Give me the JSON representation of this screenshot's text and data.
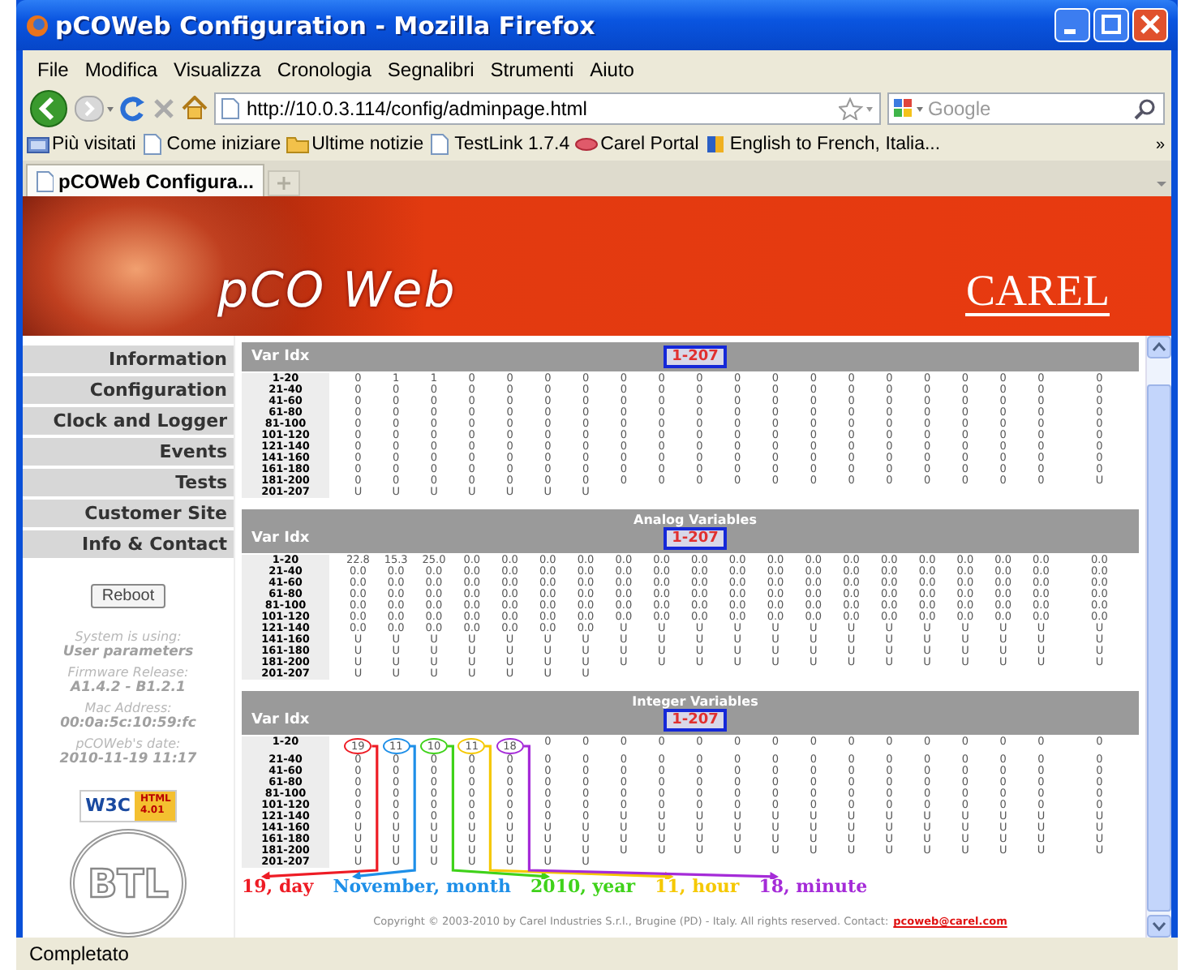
{
  "window": {
    "title": "pCOWeb Configuration - Mozilla Firefox"
  },
  "menu": [
    "File",
    "Modifica",
    "Visualizza",
    "Cronologia",
    "Segnalibri",
    "Strumenti",
    "Aiuto"
  ],
  "address": {
    "value": "http://10.0.3.114/config/adminpage.html"
  },
  "search": {
    "placeholder": "Google"
  },
  "bookmarks": [
    {
      "label": "Più visitati",
      "kind": "smart"
    },
    {
      "label": "Come iniziare",
      "kind": "page"
    },
    {
      "label": "Ultime notizie",
      "kind": "folder"
    },
    {
      "label": "TestLink 1.7.4",
      "kind": "page"
    },
    {
      "label": "Carel Portal",
      "kind": "carel"
    },
    {
      "label": "English to French, Italia...",
      "kind": "flag"
    }
  ],
  "bookmarks_overflow": "»",
  "tabs": [
    {
      "label": "pCOWeb Configura...",
      "selected": true
    }
  ],
  "banner": {
    "logo": "pCO Web",
    "brand": "CAREL"
  },
  "sidebar": {
    "items": [
      {
        "label": "Information"
      },
      {
        "label": "Configuration"
      },
      {
        "label": "Clock and Logger"
      },
      {
        "label": "Events"
      },
      {
        "label": "Tests"
      },
      {
        "label": "Customer Site"
      },
      {
        "label": "Info & Contact"
      }
    ],
    "button": "Reboot",
    "info": [
      {
        "label": "System is using:",
        "value": "User parameters"
      },
      {
        "label": "Firmware Release:",
        "value": "A1.4.2 - B1.2.1"
      },
      {
        "label": "Mac Address:",
        "value": "00:0a:5c:10:59:fc"
      },
      {
        "label": "pCOWeb's date:",
        "value": "2010-11-19 11:17"
      }
    ],
    "badge": {
      "org": "W3C",
      "spec": "HTML",
      "version": "4.01"
    },
    "seal": "BTL"
  },
  "tables": [
    {
      "index_heading": "Var Idx",
      "range": "1-207",
      "rows": [
        {
          "label": "1-20",
          "values": [
            "0",
            "1",
            "1",
            "0",
            "0",
            "0",
            "0",
            "0",
            "0",
            "0",
            "0",
            "0",
            "0",
            "0",
            "0",
            "0",
            "0",
            "0",
            "0",
            "0"
          ]
        },
        {
          "label": "21-40",
          "values": [
            "0",
            "0",
            "0",
            "0",
            "0",
            "0",
            "0",
            "0",
            "0",
            "0",
            "0",
            "0",
            "0",
            "0",
            "0",
            "0",
            "0",
            "0",
            "0",
            "0"
          ]
        },
        {
          "label": "41-60",
          "values": [
            "0",
            "0",
            "0",
            "0",
            "0",
            "0",
            "0",
            "0",
            "0",
            "0",
            "0",
            "0",
            "0",
            "0",
            "0",
            "0",
            "0",
            "0",
            "0",
            "0"
          ]
        },
        {
          "label": "61-80",
          "values": [
            "0",
            "0",
            "0",
            "0",
            "0",
            "0",
            "0",
            "0",
            "0",
            "0",
            "0",
            "0",
            "0",
            "0",
            "0",
            "0",
            "0",
            "0",
            "0",
            "0"
          ]
        },
        {
          "label": "81-100",
          "values": [
            "0",
            "0",
            "0",
            "0",
            "0",
            "0",
            "0",
            "0",
            "0",
            "0",
            "0",
            "0",
            "0",
            "0",
            "0",
            "0",
            "0",
            "0",
            "0",
            "0"
          ]
        },
        {
          "label": "101-120",
          "values": [
            "0",
            "0",
            "0",
            "0",
            "0",
            "0",
            "0",
            "0",
            "0",
            "0",
            "0",
            "0",
            "0",
            "0",
            "0",
            "0",
            "0",
            "0",
            "0",
            "0"
          ]
        },
        {
          "label": "121-140",
          "values": [
            "0",
            "0",
            "0",
            "0",
            "0",
            "0",
            "0",
            "0",
            "0",
            "0",
            "0",
            "0",
            "0",
            "0",
            "0",
            "0",
            "0",
            "0",
            "0",
            "0"
          ]
        },
        {
          "label": "141-160",
          "values": [
            "0",
            "0",
            "0",
            "0",
            "0",
            "0",
            "0",
            "0",
            "0",
            "0",
            "0",
            "0",
            "0",
            "0",
            "0",
            "0",
            "0",
            "0",
            "0",
            "0"
          ]
        },
        {
          "label": "161-180",
          "values": [
            "0",
            "0",
            "0",
            "0",
            "0",
            "0",
            "0",
            "0",
            "0",
            "0",
            "0",
            "0",
            "0",
            "0",
            "0",
            "0",
            "0",
            "0",
            "0",
            "0"
          ]
        },
        {
          "label": "181-200",
          "values": [
            "0",
            "0",
            "0",
            "0",
            "0",
            "0",
            "0",
            "0",
            "0",
            "0",
            "0",
            "0",
            "0",
            "0",
            "0",
            "0",
            "0",
            "0",
            "0",
            "U"
          ]
        },
        {
          "label": "201-207",
          "values": [
            "U",
            "U",
            "U",
            "U",
            "U",
            "U",
            "U"
          ]
        }
      ]
    },
    {
      "title": "Analog Variables",
      "index_heading": "Var Idx",
      "range": "1-207",
      "rows": [
        {
          "label": "1-20",
          "values": [
            "22.8",
            "15.3",
            "25.0",
            "0.0",
            "0.0",
            "0.0",
            "0.0",
            "0.0",
            "0.0",
            "0.0",
            "0.0",
            "0.0",
            "0.0",
            "0.0",
            "0.0",
            "0.0",
            "0.0",
            "0.0",
            "0.0",
            "0.0"
          ]
        },
        {
          "label": "21-40",
          "values": [
            "0.0",
            "0.0",
            "0.0",
            "0.0",
            "0.0",
            "0.0",
            "0.0",
            "0.0",
            "0.0",
            "0.0",
            "0.0",
            "0.0",
            "0.0",
            "0.0",
            "0.0",
            "0.0",
            "0.0",
            "0.0",
            "0.0",
            "0.0"
          ]
        },
        {
          "label": "41-60",
          "values": [
            "0.0",
            "0.0",
            "0.0",
            "0.0",
            "0.0",
            "0.0",
            "0.0",
            "0.0",
            "0.0",
            "0.0",
            "0.0",
            "0.0",
            "0.0",
            "0.0",
            "0.0",
            "0.0",
            "0.0",
            "0.0",
            "0.0",
            "0.0"
          ]
        },
        {
          "label": "61-80",
          "values": [
            "0.0",
            "0.0",
            "0.0",
            "0.0",
            "0.0",
            "0.0",
            "0.0",
            "0.0",
            "0.0",
            "0.0",
            "0.0",
            "0.0",
            "0.0",
            "0.0",
            "0.0",
            "0.0",
            "0.0",
            "0.0",
            "0.0",
            "0.0"
          ]
        },
        {
          "label": "81-100",
          "values": [
            "0.0",
            "0.0",
            "0.0",
            "0.0",
            "0.0",
            "0.0",
            "0.0",
            "0.0",
            "0.0",
            "0.0",
            "0.0",
            "0.0",
            "0.0",
            "0.0",
            "0.0",
            "0.0",
            "0.0",
            "0.0",
            "0.0",
            "0.0"
          ]
        },
        {
          "label": "101-120",
          "values": [
            "0.0",
            "0.0",
            "0.0",
            "0.0",
            "0.0",
            "0.0",
            "0.0",
            "0.0",
            "0.0",
            "0.0",
            "0.0",
            "0.0",
            "0.0",
            "0.0",
            "0.0",
            "0.0",
            "0.0",
            "0.0",
            "0.0",
            "0.0"
          ]
        },
        {
          "label": "121-140",
          "values": [
            "0.0",
            "0.0",
            "0.0",
            "0.0",
            "0.0",
            "0.0",
            "0.0",
            "U",
            "U",
            "U",
            "U",
            "U",
            "U",
            "U",
            "U",
            "U",
            "U",
            "U",
            "U",
            "U"
          ]
        },
        {
          "label": "141-160",
          "values": [
            "U",
            "U",
            "U",
            "U",
            "U",
            "U",
            "U",
            "U",
            "U",
            "U",
            "U",
            "U",
            "U",
            "U",
            "U",
            "U",
            "U",
            "U",
            "U",
            "U"
          ]
        },
        {
          "label": "161-180",
          "values": [
            "U",
            "U",
            "U",
            "U",
            "U",
            "U",
            "U",
            "U",
            "U",
            "U",
            "U",
            "U",
            "U",
            "U",
            "U",
            "U",
            "U",
            "U",
            "U",
            "U"
          ]
        },
        {
          "label": "181-200",
          "values": [
            "U",
            "U",
            "U",
            "U",
            "U",
            "U",
            "U",
            "U",
            "U",
            "U",
            "U",
            "U",
            "U",
            "U",
            "U",
            "U",
            "U",
            "U",
            "U",
            "U"
          ]
        },
        {
          "label": "201-207",
          "values": [
            "U",
            "U",
            "U",
            "U",
            "U",
            "U",
            "U"
          ]
        }
      ]
    },
    {
      "title": "Integer Variables",
      "index_heading": "Var Idx",
      "range": "1-207",
      "rows": [
        {
          "label": "1-20",
          "values": [
            "19",
            "11",
            "10",
            "11",
            "18",
            "0",
            "0",
            "0",
            "0",
            "0",
            "0",
            "0",
            "0",
            "0",
            "0",
            "0",
            "0",
            "0",
            "0",
            "0"
          ]
        },
        {
          "label": "21-40",
          "values": [
            "0",
            "0",
            "0",
            "0",
            "0",
            "0",
            "0",
            "0",
            "0",
            "0",
            "0",
            "0",
            "0",
            "0",
            "0",
            "0",
            "0",
            "0",
            "0",
            "0"
          ]
        },
        {
          "label": "41-60",
          "values": [
            "0",
            "0",
            "0",
            "0",
            "0",
            "0",
            "0",
            "0",
            "0",
            "0",
            "0",
            "0",
            "0",
            "0",
            "0",
            "0",
            "0",
            "0",
            "0",
            "0"
          ]
        },
        {
          "label": "61-80",
          "values": [
            "0",
            "0",
            "0",
            "0",
            "0",
            "0",
            "0",
            "0",
            "0",
            "0",
            "0",
            "0",
            "0",
            "0",
            "0",
            "0",
            "0",
            "0",
            "0",
            "0"
          ]
        },
        {
          "label": "81-100",
          "values": [
            "0",
            "0",
            "0",
            "0",
            "0",
            "0",
            "0",
            "0",
            "0",
            "0",
            "0",
            "0",
            "0",
            "0",
            "0",
            "0",
            "0",
            "0",
            "0",
            "0"
          ]
        },
        {
          "label": "101-120",
          "values": [
            "0",
            "0",
            "0",
            "0",
            "0",
            "0",
            "0",
            "0",
            "0",
            "0",
            "0",
            "0",
            "0",
            "0",
            "0",
            "0",
            "0",
            "0",
            "0",
            "0"
          ]
        },
        {
          "label": "121-140",
          "values": [
            "0",
            "0",
            "0",
            "0",
            "0",
            "0",
            "0",
            "U",
            "U",
            "U",
            "U",
            "U",
            "U",
            "U",
            "U",
            "U",
            "U",
            "U",
            "U",
            "U"
          ]
        },
        {
          "label": "141-160",
          "values": [
            "U",
            "U",
            "U",
            "U",
            "U",
            "U",
            "U",
            "U",
            "U",
            "U",
            "U",
            "U",
            "U",
            "U",
            "U",
            "U",
            "U",
            "U",
            "U",
            "U"
          ]
        },
        {
          "label": "161-180",
          "values": [
            "U",
            "U",
            "U",
            "U",
            "U",
            "U",
            "U",
            "U",
            "U",
            "U",
            "U",
            "U",
            "U",
            "U",
            "U",
            "U",
            "U",
            "U",
            "U",
            "U"
          ]
        },
        {
          "label": "181-200",
          "values": [
            "U",
            "U",
            "U",
            "U",
            "U",
            "U",
            "U",
            "U",
            "U",
            "U",
            "U",
            "U",
            "U",
            "U",
            "U",
            "U",
            "U",
            "U",
            "U",
            "U"
          ]
        },
        {
          "label": "201-207",
          "values": [
            "U",
            "U",
            "U",
            "U",
            "U",
            "U",
            "U"
          ]
        }
      ],
      "annotations": [
        {
          "text": "19, day",
          "color": "#ee1c25"
        },
        {
          "text": "November, month",
          "color": "#1e8fe8"
        },
        {
          "text": "2010, year",
          "color": "#3fd21a"
        },
        {
          "text": "11, hour",
          "color": "#f5c800"
        },
        {
          "text": "18, minute",
          "color": "#a52bd8"
        }
      ]
    }
  ],
  "footer": {
    "text": "Copyright © 2003-2010 by Carel Industries S.r.l., Brugine (PD) - Italy. All rights reserved. Contact:",
    "link": "pcoweb@carel.com"
  },
  "status_bar": "Completato"
}
